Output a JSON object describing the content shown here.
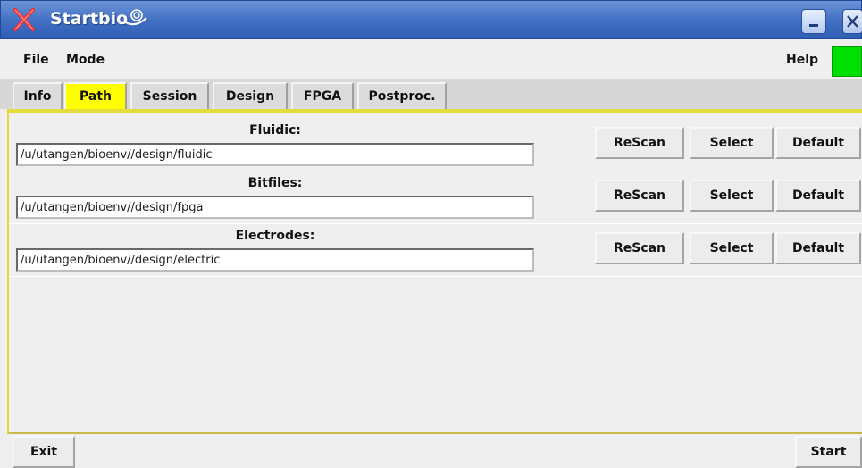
{
  "window": {
    "title": "Startbio"
  },
  "menu": {
    "file": "File",
    "mode": "Mode",
    "help": "Help",
    "status_color": "#00e000"
  },
  "tabs": [
    {
      "label": "Info",
      "active": false
    },
    {
      "label": "Path",
      "active": true
    },
    {
      "label": "Session",
      "active": false
    },
    {
      "label": "Design",
      "active": false
    },
    {
      "label": "FPGA",
      "active": false
    },
    {
      "label": "Postproc.",
      "active": false
    }
  ],
  "paths": {
    "fluidic": {
      "label": "Fluidic:",
      "value": "/u/utangen/bioenv//design/fluidic"
    },
    "bitfiles": {
      "label": "Bitfiles:",
      "value": "/u/utangen/bioenv//design/fpga"
    },
    "electrodes": {
      "label": "Electrodes:",
      "value": "/u/utangen/bioenv//design/electric"
    }
  },
  "buttons": {
    "rescan": "ReScan",
    "select": "Select",
    "default": "Default",
    "exit": "Exit",
    "start": "Start"
  },
  "colors": {
    "active_tab": "#ffff00",
    "titlebar": "#3f6ec2",
    "panel_border": "#e4dc3c"
  }
}
